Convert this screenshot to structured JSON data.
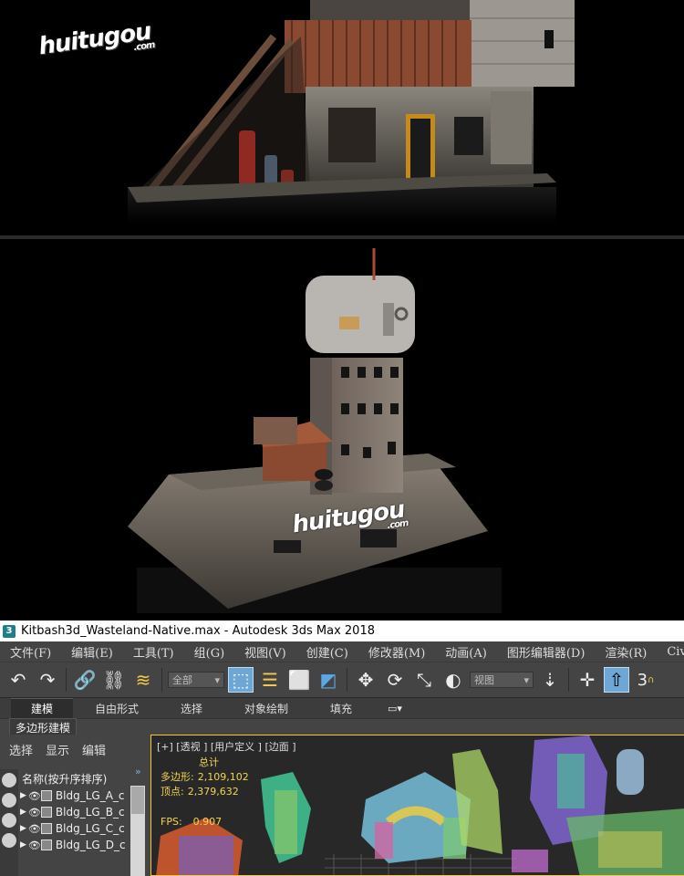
{
  "watermark": {
    "brand": "huitugou",
    "suffix": ".com"
  },
  "window": {
    "title": "Kitbash3d_Wasteland-Native.max - Autodesk 3ds Max 2018",
    "app_icon": "3"
  },
  "menu": [
    "文件(F)",
    "编辑(E)",
    "工具(T)",
    "组(G)",
    "视图(V)",
    "创建(C)",
    "修改器(M)",
    "动画(A)",
    "图形编辑器(D)",
    "渲染(R)",
    "Civil"
  ],
  "toolbar": {
    "selection_filter": "全部",
    "coord_system": "视图",
    "tools": [
      "undo-icon",
      "redo-icon",
      "link-icon",
      "unlink-icon",
      "bind-spacewarp-icon",
      "select-object-icon",
      "select-by-name-icon",
      "rect-selection-icon",
      "window-crossing-icon",
      "move-icon",
      "rotate-icon",
      "scale-icon",
      "select-manipulate-icon",
      "snap-toggle-icon",
      "pivot-icon",
      "select-and-place-icon",
      "3d-snap-icon"
    ]
  },
  "ribbon": {
    "tabs": [
      "建模",
      "自由形式",
      "选择",
      "对象绘制",
      "填充"
    ],
    "active_tab": "建模",
    "panel_label": "多边形建模"
  },
  "scene_explorer": {
    "tabs": [
      "选择",
      "显示",
      "编辑"
    ],
    "column_header": "名称(按升序排序)",
    "items": [
      "Bldg_LG_A_c",
      "Bldg_LG_B_c",
      "Bldg_LG_C_c",
      "Bldg_LG_D_c"
    ]
  },
  "viewport": {
    "label": "[+] [透视 ] [用户定义 ] [边面 ]",
    "stats_header": "总计",
    "polygons_label": "多边形:",
    "polygons_value": "2,109,102",
    "vertices_label": "顶点:",
    "vertices_value": "2,379,632",
    "fps_label": "FPS:",
    "fps_value": "0.907"
  },
  "colors": {
    "viewport_border": "#f7c63c",
    "stats_text": "#f2d64e",
    "active_tool": "#6ea7d6"
  }
}
